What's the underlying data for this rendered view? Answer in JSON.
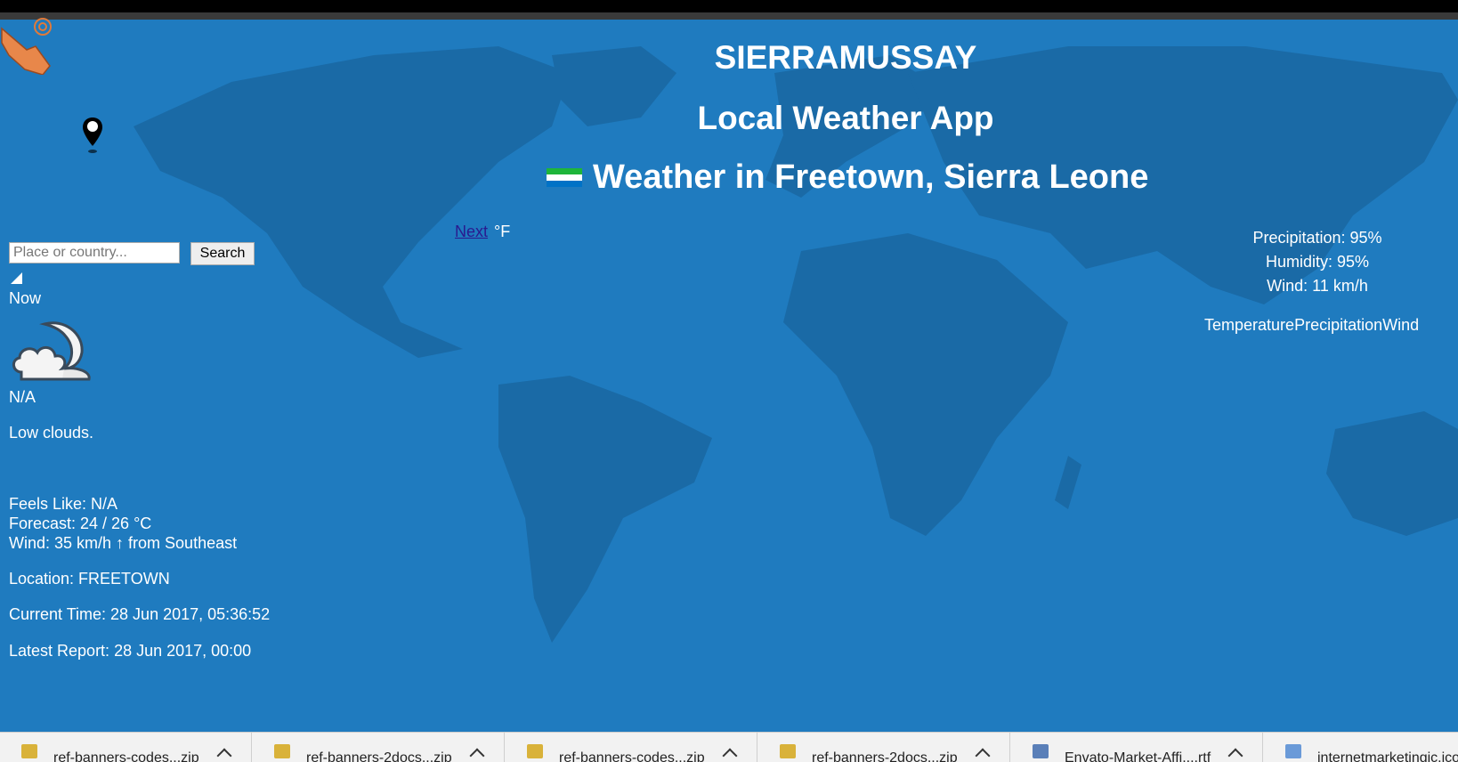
{
  "header": {
    "site_title": "SIERRAMUSSAY",
    "app_title": "Local Weather App",
    "weather_title": "Weather in Freetown, Sierra Leone",
    "flag_colors": [
      "#1eb53a",
      "#ffffff",
      "#0072c6"
    ]
  },
  "controls": {
    "next_label": "Next",
    "unit_label": "°F",
    "search_placeholder": "Place or country...",
    "search_button": "Search"
  },
  "current": {
    "now_label": "Now",
    "icon": "moon-cloud-icon",
    "temperature": "N/A",
    "description": "Low clouds.",
    "feels_like": "Feels Like: N/A",
    "forecast": "Forecast: 24 / 26 °C",
    "wind": "Wind: 35 km/h ↑ from Southeast",
    "location": "Location: FREETOWN",
    "current_time": "Current Time: 28 Jun 2017, 05:36:52",
    "latest_report": "Latest Report: 28 Jun 2017, 00:00"
  },
  "stats": {
    "precipitation": "Precipitation: 95%",
    "humidity": "Humidity: 95%",
    "wind": "Wind: 11 km/h",
    "tabs": [
      "Temperature",
      "Precipitation",
      "Wind"
    ]
  },
  "downloads": [
    {
      "name": "ref-banners-codes...zip",
      "icon": "zip-icon"
    },
    {
      "name": "ref-banners-2docs...zip",
      "icon": "zip-icon"
    },
    {
      "name": "ref-banners-codes...zip",
      "icon": "zip-icon"
    },
    {
      "name": "ref-banners-2docs...zip",
      "icon": "zip-icon"
    },
    {
      "name": "Envato-Market-Affi....rtf",
      "icon": "document-icon"
    },
    {
      "name": "internetmarketingic.ico",
      "icon": "image-icon"
    }
  ],
  "colors": {
    "background": "#1f7bbf",
    "continents": "#1a6aa6",
    "link": "#2a1a8f"
  }
}
